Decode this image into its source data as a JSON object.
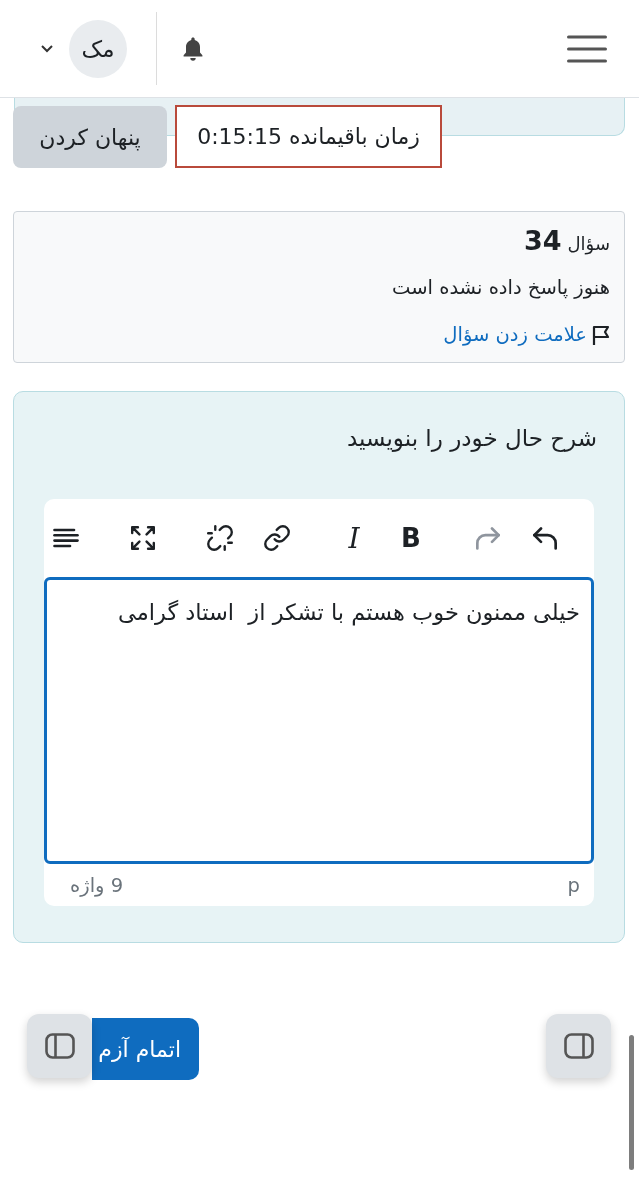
{
  "header": {
    "user_initials": "مک"
  },
  "timer": {
    "hide_button": "پنهان کردن",
    "remaining": "زمان باقیمانده 0:15:15"
  },
  "question_info": {
    "label": "سؤال",
    "number": "34",
    "status": "هنوز پاسخ داده نشده است",
    "flag_link": "علامت زدن سؤال"
  },
  "question": {
    "text": "شرح حال خودر را بنویسید",
    "editor": {
      "toolbar_groups": [
        {
          "buttons": [
            {
              "kind": "undo",
              "disabled": false
            },
            {
              "kind": "redo",
              "disabled": true
            }
          ]
        },
        {
          "buttons": [
            {
              "kind": "bold",
              "label": "B",
              "disabled": false
            },
            {
              "kind": "italic",
              "label": "I",
              "disabled": false
            }
          ]
        },
        {
          "buttons": [
            {
              "kind": "link",
              "disabled": false
            },
            {
              "kind": "unlink",
              "disabled": false
            }
          ]
        },
        {
          "buttons": [
            {
              "kind": "fullscreen",
              "disabled": false
            }
          ]
        },
        {
          "buttons": [
            {
              "kind": "align",
              "disabled": false
            }
          ]
        }
      ],
      "value": "خیلی ممنون خوب هستم با تشکر از  استاد گرامی",
      "element_path": "p",
      "word_count": "9 واژه"
    }
  },
  "finish_button": "اتمام آزم"
}
